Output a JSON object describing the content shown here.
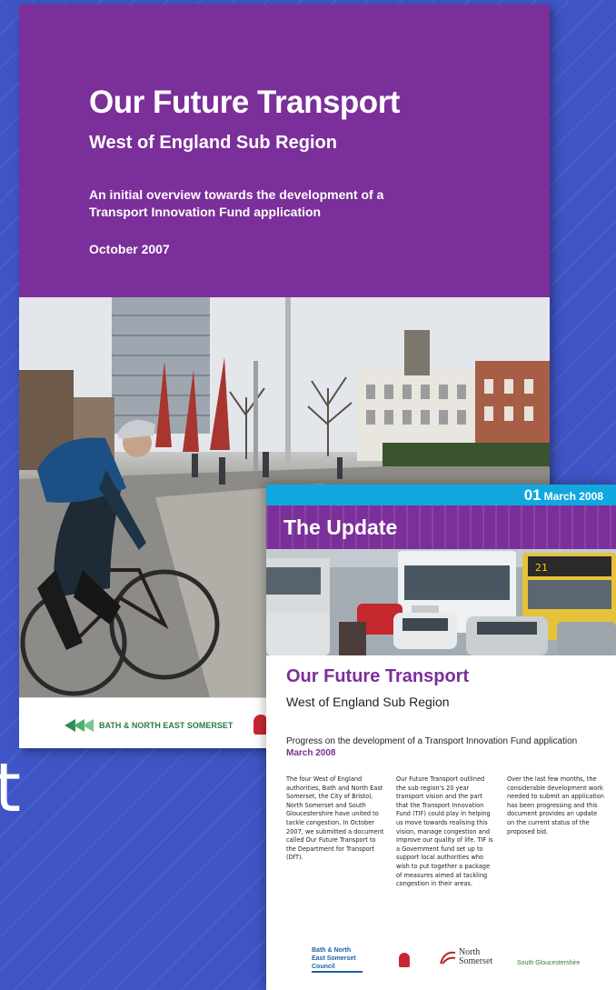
{
  "cover1": {
    "title": "Our Future Transport",
    "subtitle": "West of England Sub Region",
    "description": "An initial overview towards the development of a Transport Innovation Fund application",
    "date": "October 2007",
    "footer_logo": "BATH & NORTH EAST SOMERSET"
  },
  "cover2": {
    "issue_number": "01",
    "issue_month": "March 2008",
    "banner_title": "The Update",
    "heading": "Our Future Transport",
    "subheading": "West of England Sub Region",
    "progress_text": "Progress on the development of a Transport Innovation Fund application",
    "progress_date": "March 2008",
    "columns": [
      "The four West of England authorities, Bath and North East Somerset, the City of Bristol, North Somerset and South Gloucestershire have united to tackle congestion. In October 2007, we submitted a document called Our Future Transport to the Department for Transport (DfT).",
      "Our Future Transport outlined the sub region's 20 year transport vision and the part that the Transport Innovation Fund (TIF) could play in helping us move towards realising this vision, manage congestion and improve our quality of life. TIF is a Government fund set up to support local authorities who wish to put together a package of measures aimed at tackling congestion in their areas.",
      "Over the last few months, the considerable development work needed to submit an application has been progressing and this document provides an update on the current status of the proposed bid."
    ],
    "logos": {
      "bath": "Bath & North East Somerset Council",
      "north_somerset_1": "North",
      "north_somerset_2": "Somerset",
      "south_glos": "South Gloucestershire"
    }
  },
  "background_glyph": "t",
  "colors": {
    "background": "#3f55c6",
    "purple": "#7b2f9a",
    "cyan": "#11a7df",
    "white": "#ffffff"
  }
}
